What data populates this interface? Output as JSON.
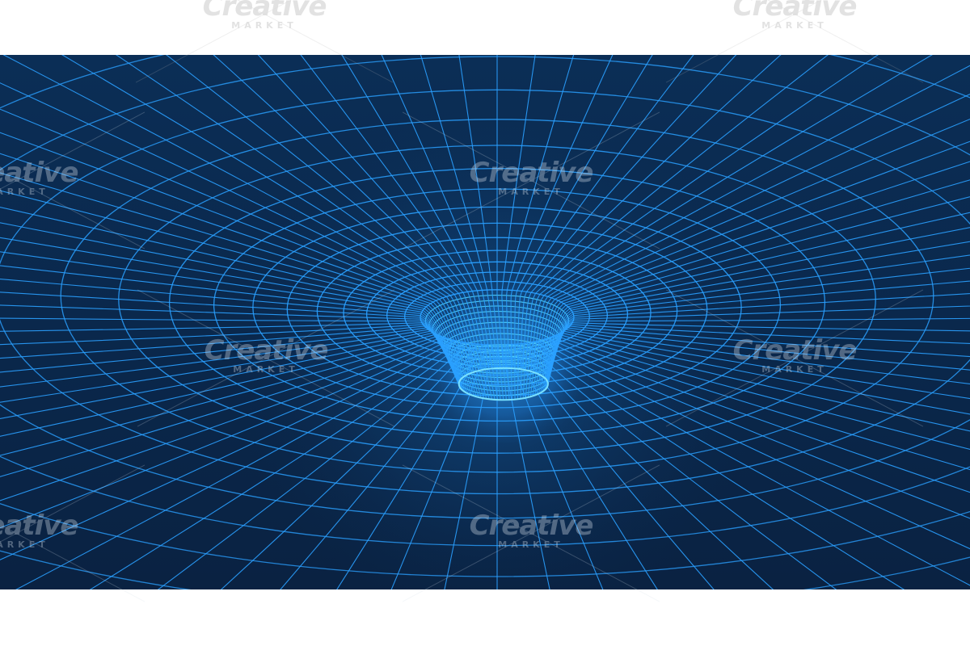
{
  "watermark": {
    "word": "Creative",
    "sub": "MARKET"
  },
  "colors": {
    "page_background": "#ffffff",
    "background_top": "#0b2d52",
    "background_bottom": "#0a2240",
    "grid_line": "#2aa0ff",
    "grid_glow": "#4fd4ff"
  }
}
